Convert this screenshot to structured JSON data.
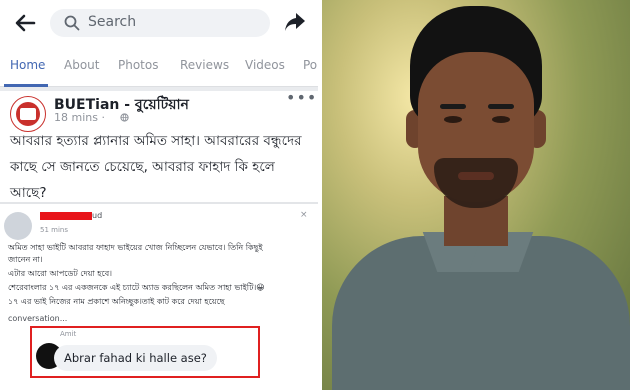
{
  "topbar": {
    "search_placeholder": "Search"
  },
  "tabs": [
    {
      "label": "Home",
      "active": true
    },
    {
      "label": "About"
    },
    {
      "label": "Photos"
    },
    {
      "label": "Reviews"
    },
    {
      "label": "Videos"
    },
    {
      "label": "Po"
    }
  ],
  "post": {
    "page_name": "BUETian - বুয়েটিয়ান",
    "time": "18 mins ·",
    "text": "আবরার হত্যার প্ল্যানার অমিত সাহা। আবরারের বন্ধুদের কাছে সে জানতে চেয়েছে, আবরার ফাহাদ কি হলে আছে?",
    "more_glyph": "•••"
  },
  "embedded": {
    "name_fragment": "ud",
    "time": "51 mins",
    "close_glyph": "×",
    "lines": [
      "অমিত সাহা ভাইটি আবরার ফাহাদ ভাইয়ের খোজ নিচ্ছিলেন যেভাবে। তিনি কিছুই",
      "জানেন না।",
      "এটার আরো আপডেট দেয়া হবে।",
      "শেরেবাংলার ১৭ এর একজনকে এই চ্যাটে অ্যাড করছিলেন অমিত সাহা ভাইটি।😀",
      "১৭ এর ভাই নিজের নাম প্রকাশে অনিচ্ছুক।তাই কাট করে দেয়া হয়েছে"
    ],
    "conversation": "conversation...",
    "chat_sender": "Amit",
    "chat_message": "Abrar fahad ki halle ase?"
  },
  "colors": {
    "facebook_blue": "#4267b2",
    "highlight_red": "#e02020",
    "redaction_red": "#e8141a"
  }
}
